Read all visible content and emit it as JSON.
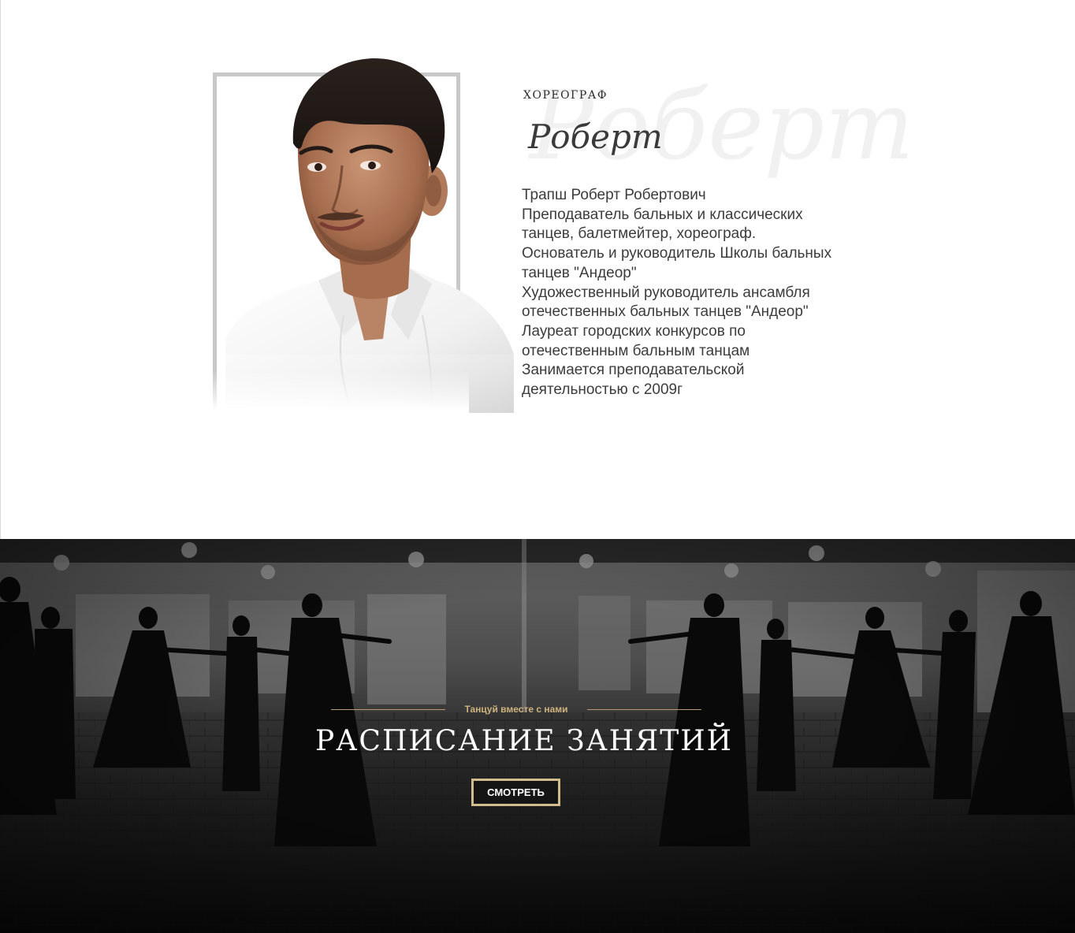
{
  "profile": {
    "role": "ХОРЕОГРАФ",
    "name_script": "Роберт",
    "name_ghost": "Роберт",
    "bio_lines": [
      "Трапш Роберт Робертович",
      "Преподаватель бальных и классических",
      "танцев, балетмейтер, хореограф.",
      "Основатель и руководитель Школы бальных",
      "танцев \"Андеор\"",
      "Художественный руководитель ансамбля",
      "отечественных бальных танцев \"Андеор\"",
      "Лауреат городских конкурсов по",
      "отечественным бальным танцам",
      "Занимается преподавательской",
      "деятельностью с 2009г"
    ]
  },
  "schedule_banner": {
    "tagline": "Танцуй вместе с нами",
    "title": "РАСПИСАНИЕ ЗАНЯТИЙ",
    "button_label": "СМОТРЕТЬ"
  },
  "colors": {
    "accent_gold": "#cdb27e",
    "button_border": "#d3bc8c",
    "frame_gray": "#c8c8c8",
    "text_dark": "#3c3c3c"
  }
}
